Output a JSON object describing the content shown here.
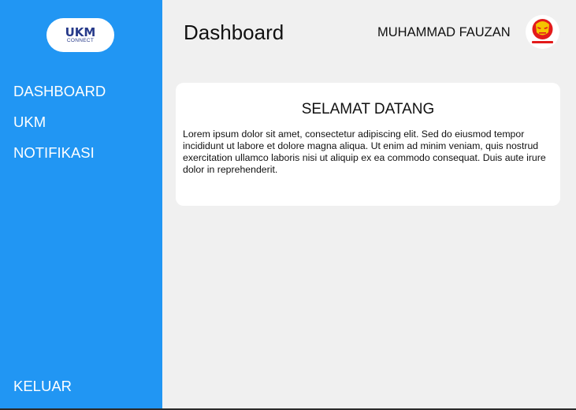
{
  "sidebar": {
    "logo": {
      "mark": "UKM",
      "sub": "CONNECT"
    },
    "items": [
      {
        "label": "DASHBOARD"
      },
      {
        "label": "UKM"
      },
      {
        "label": "NOTIFIKASI"
      }
    ],
    "logout_label": "KELUAR",
    "color": "#2196f3"
  },
  "header": {
    "title": "Dashboard",
    "user_name": "MUHAMMAD FAUZAN",
    "avatar_icon": "iron-man-helmet-icon"
  },
  "main": {
    "card": {
      "title": "SELAMAT DATANG",
      "body": "Lorem ipsum dolor sit amet, consectetur adipiscing elit. Sed do eiusmod tempor incididunt ut labore et dolore magna aliqua. Ut enim ad minim veniam, quis nostrud exercitation ullamco laboris nisi ut aliquip ex ea commodo consequat. Duis aute irure dolor in reprehenderit."
    }
  }
}
